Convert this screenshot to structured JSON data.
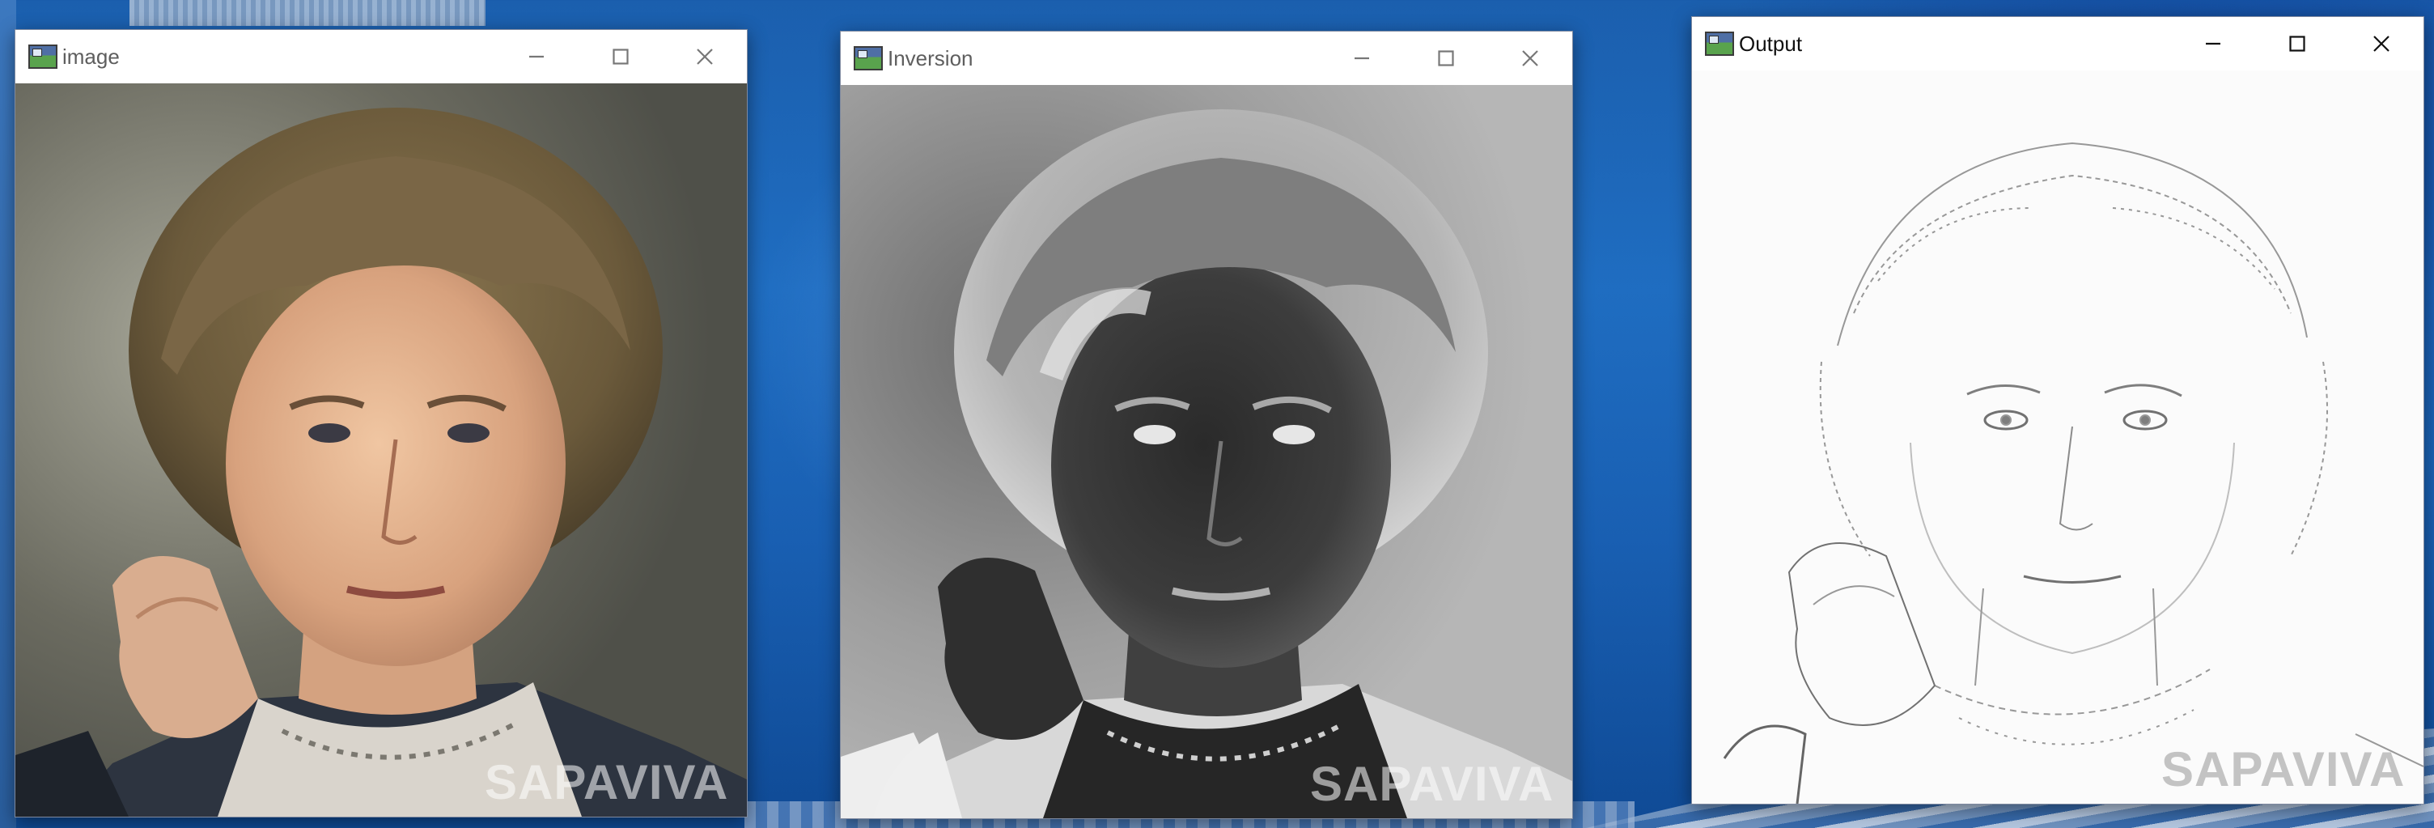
{
  "windows": [
    {
      "id": "image",
      "title": "image",
      "active": false,
      "watermark": "SAPAVIVA",
      "controls": {
        "minimize": "minimize",
        "maximize": "maximize",
        "close": "close"
      }
    },
    {
      "id": "inversion",
      "title": "Inversion",
      "active": false,
      "watermark": "SAPAVIVA",
      "controls": {
        "minimize": "minimize",
        "maximize": "maximize",
        "close": "close"
      }
    },
    {
      "id": "output",
      "title": "Output",
      "active": true,
      "watermark": "SAPAVIVA",
      "controls": {
        "minimize": "minimize",
        "maximize": "maximize",
        "close": "close"
      }
    }
  ],
  "icons": {
    "app": "image-viewer-icon",
    "minimize": "minimize-icon",
    "maximize": "maximize-icon",
    "close": "close-icon"
  }
}
